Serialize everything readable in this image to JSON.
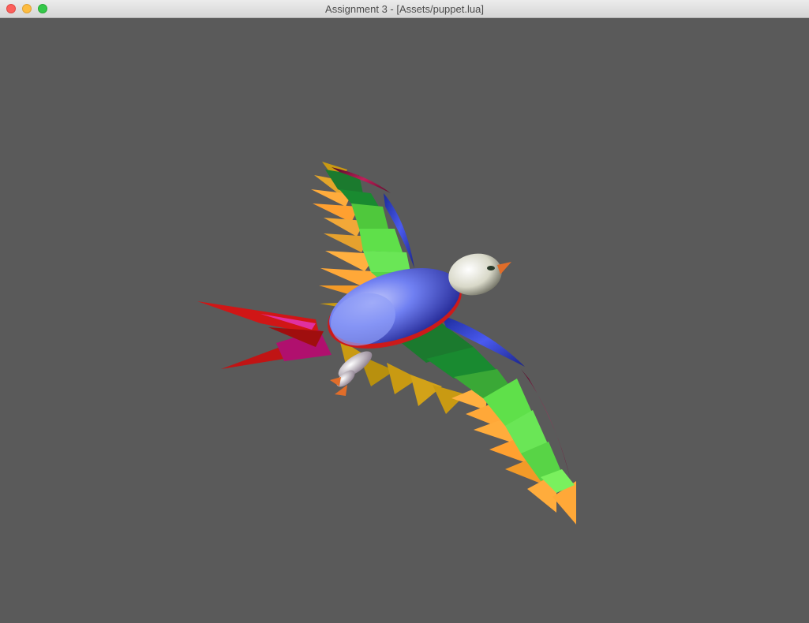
{
  "window": {
    "title": "Assignment 3 - [Assets/puppet.lua]",
    "controls": {
      "close": "close-icon",
      "minimize": "minimize-icon",
      "maximize": "maximize-icon"
    }
  },
  "scene": {
    "description_icon": "bird-puppet-icon",
    "background_color": "#5a5a5a",
    "colors": {
      "body": "#5b6bf0",
      "head": "#e8e8dc",
      "wing_dark_green": "#1b7a2e",
      "wing_green": "#5fe04a",
      "feather_orange": "#ffa838",
      "feather_gold": "#c79a10",
      "wing_blue": "#2b3fd0",
      "wing_maroon": "#8a1040",
      "tail_red": "#d21616",
      "tail_magenta": "#c01a8a"
    }
  }
}
